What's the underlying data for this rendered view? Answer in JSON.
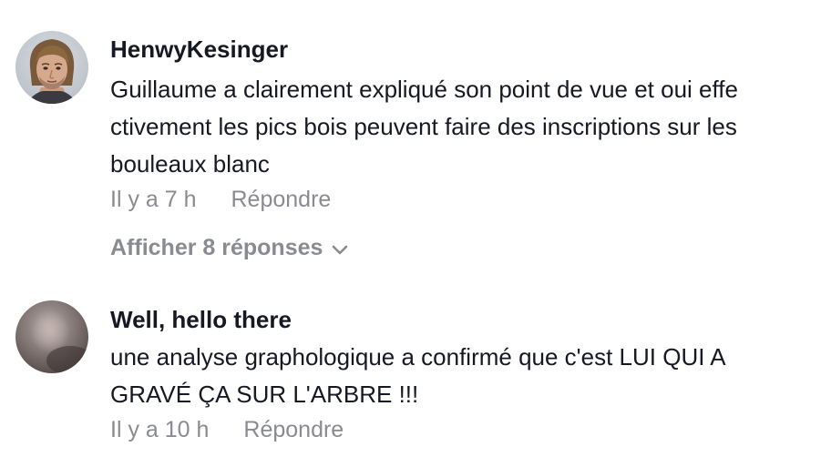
{
  "comments": [
    {
      "username": "HenwyKesinger",
      "line1": "Guillaume a clairement expliqué son point de vue et oui effe",
      "line2": "ctivement les pics bois peuvent faire des inscriptions sur les",
      "line3": "bouleaux blanc",
      "time": "Il y a 7 h",
      "reply_label": "Répondre",
      "view_replies_label": "Afficher 8 réponses",
      "avatar_icon": "person-photo-avatar"
    },
    {
      "username": "Well, hello there",
      "line1": "une analyse graphologique a confirmé que c'est LUI QUI A",
      "line2": "GRAVÉ ÇA SUR L'ARBRE !!!",
      "time": "Il y a 10 h",
      "reply_label": "Répondre",
      "avatar_icon": "blurred-photo-avatar"
    }
  ],
  "colors": {
    "primary_text": "#161823",
    "secondary_text": "#8a8b91",
    "background": "#ffffff"
  }
}
